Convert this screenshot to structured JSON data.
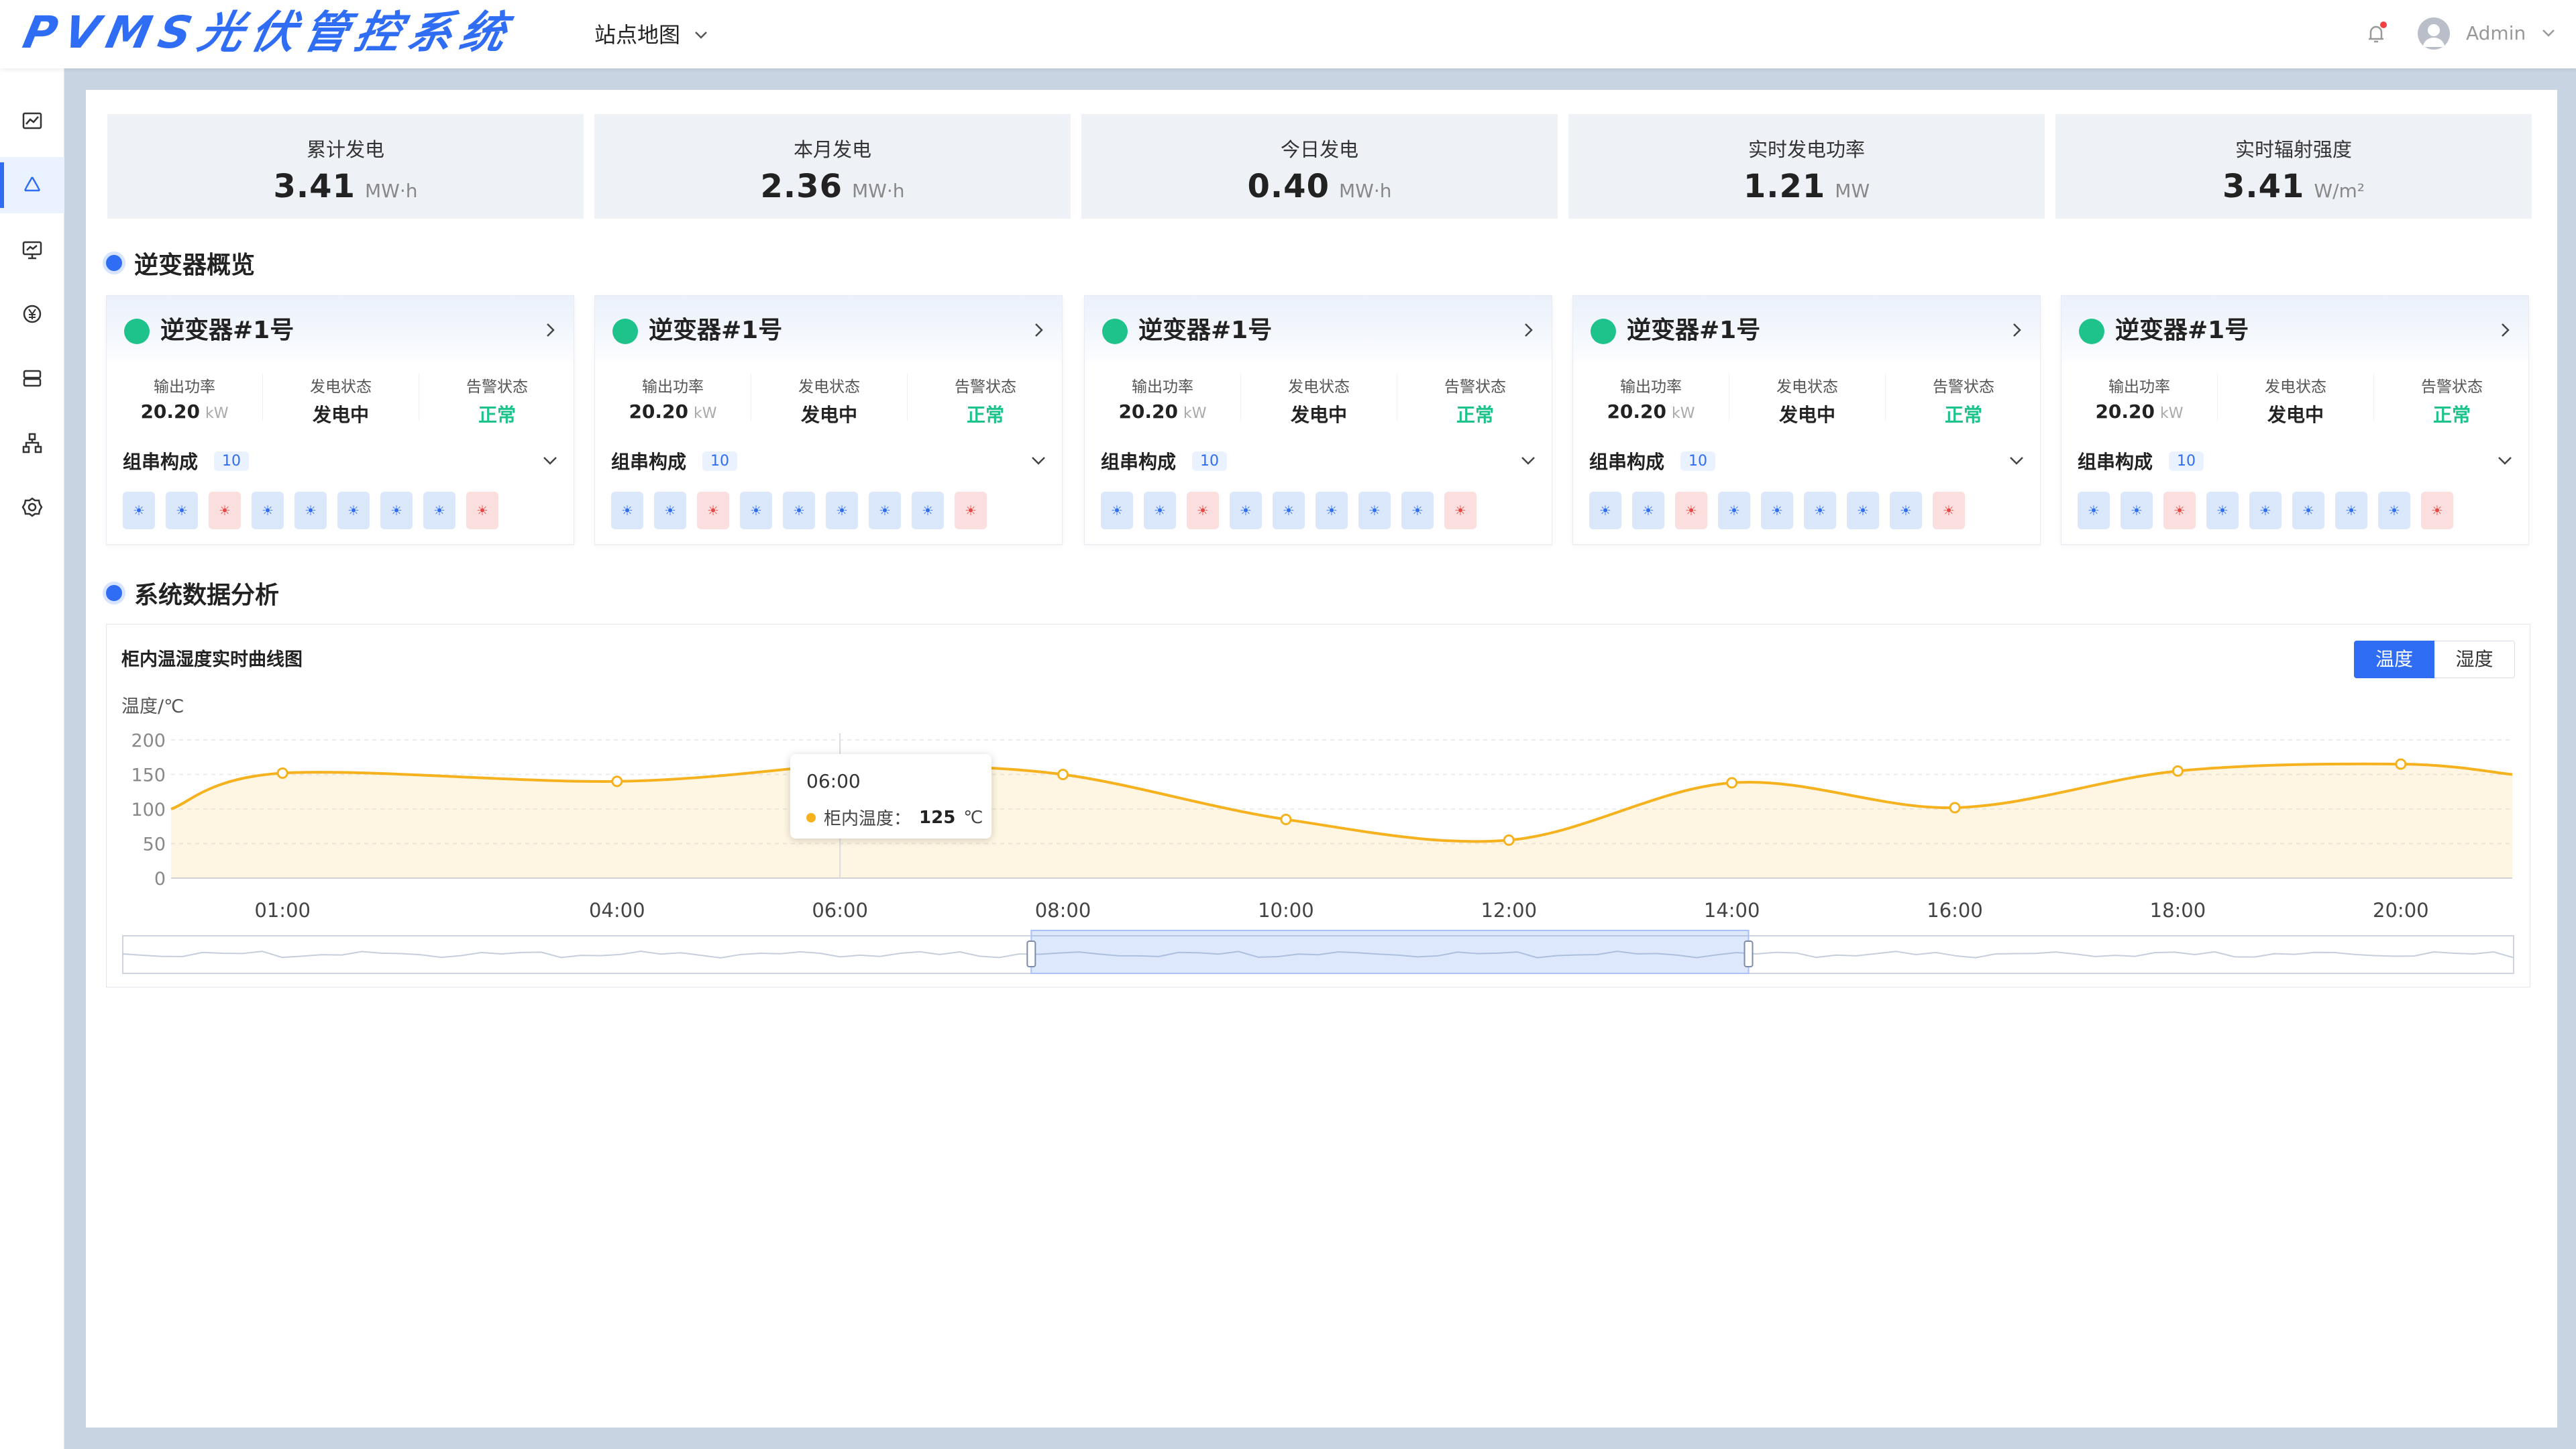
{
  "app": {
    "title": "PVMS光伏管控系统",
    "site_select": "站点地图",
    "user": "Admin"
  },
  "sidebar": {
    "items": [
      {
        "name": "sidebar-item-trend",
        "icon": "line-chart-icon"
      },
      {
        "name": "sidebar-item-overview",
        "icon": "recycle-icon",
        "active": true
      },
      {
        "name": "sidebar-item-monitor",
        "icon": "monitor-icon"
      },
      {
        "name": "sidebar-item-revenue",
        "icon": "yuan-icon"
      },
      {
        "name": "sidebar-item-storage",
        "icon": "database-icon"
      },
      {
        "name": "sidebar-item-topology",
        "icon": "network-icon"
      },
      {
        "name": "sidebar-item-settings",
        "icon": "gear-icon"
      }
    ]
  },
  "stats": [
    {
      "label": "累计发电",
      "value": "3.41",
      "unit": "MW·h"
    },
    {
      "label": "本月发电",
      "value": "2.36",
      "unit": "MW·h"
    },
    {
      "label": "今日发电",
      "value": "0.40",
      "unit": "MW·h"
    },
    {
      "label": "实时发电功率",
      "value": "1.21",
      "unit": "MW"
    },
    {
      "label": "实时辐射强度",
      "value": "3.41",
      "unit": "W/m²"
    }
  ],
  "inverter_section": {
    "title": "逆变器概览"
  },
  "inverter_labels": {
    "power": "输出功率",
    "gen_status": "发电状态",
    "alarm_status": "告警状态",
    "composition": "组串构成"
  },
  "inverters": [
    {
      "name": "逆变器#1号",
      "power": "20.20",
      "power_unit": "kW",
      "gen_status": "发电中",
      "alarm_status": "正常",
      "string_count": "10",
      "strings": [
        "normal",
        "normal",
        "alarm",
        "normal",
        "normal",
        "normal",
        "normal",
        "normal",
        "alarm"
      ]
    },
    {
      "name": "逆变器#1号",
      "power": "20.20",
      "power_unit": "kW",
      "gen_status": "发电中",
      "alarm_status": "正常",
      "string_count": "10",
      "strings": [
        "normal",
        "normal",
        "alarm",
        "normal",
        "normal",
        "normal",
        "normal",
        "normal",
        "alarm"
      ]
    },
    {
      "name": "逆变器#1号",
      "power": "20.20",
      "power_unit": "kW",
      "gen_status": "发电中",
      "alarm_status": "正常",
      "string_count": "10",
      "strings": [
        "normal",
        "normal",
        "alarm",
        "normal",
        "normal",
        "normal",
        "normal",
        "normal",
        "alarm"
      ]
    },
    {
      "name": "逆变器#1号",
      "power": "20.20",
      "power_unit": "kW",
      "gen_status": "发电中",
      "alarm_status": "正常",
      "string_count": "10",
      "strings": [
        "normal",
        "normal",
        "alarm",
        "normal",
        "normal",
        "normal",
        "normal",
        "normal",
        "alarm"
      ]
    },
    {
      "name": "逆变器#1号",
      "power": "20.20",
      "power_unit": "kW",
      "gen_status": "发电中",
      "alarm_status": "正常",
      "string_count": "10",
      "strings": [
        "normal",
        "normal",
        "alarm",
        "normal",
        "normal",
        "normal",
        "normal",
        "normal",
        "alarm"
      ]
    }
  ],
  "analysis_section": {
    "title": "系统数据分析"
  },
  "chart_card": {
    "title": "柜内温湿度实时曲线图",
    "toggle_active": "温度",
    "toggle_inactive": "湿度"
  },
  "tooltip": {
    "time": "06:00",
    "series": "柜内温度：",
    "value": "125",
    "unit": "℃"
  },
  "colors": {
    "accent": "#2f6df4",
    "line": "#f5b21e",
    "ok": "#1ec28b",
    "alarm": "#e94646"
  },
  "chart_data": {
    "type": "area",
    "ylabel": "温度/℃",
    "ylim": [
      0,
      200
    ],
    "yticks": [
      "200",
      "150",
      "100",
      "50",
      "0"
    ],
    "xticks": [
      "01:00",
      "04:00",
      "06:00",
      "08:00",
      "10:00",
      "12:00",
      "14:00",
      "16:00",
      "18:00",
      "20:00"
    ],
    "series": [
      {
        "name": "柜内温度",
        "x": [
          0,
          1,
          4,
          6,
          6.3,
          8,
          10,
          12,
          14,
          16,
          18,
          20,
          21
        ],
        "values": [
          100,
          152,
          140,
          165,
          165,
          150,
          85,
          55,
          138,
          102,
          155,
          165,
          150
        ]
      }
    ],
    "tooltip_x": 6,
    "data_zoom": [
      0.38,
      0.68
    ]
  }
}
